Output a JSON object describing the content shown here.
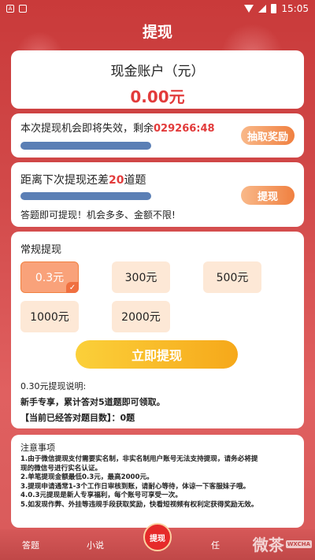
{
  "status_bar": {
    "left_icons": [
      "square-a-icon",
      "sim-icon"
    ],
    "time": "15:05"
  },
  "page": {
    "title": "提现"
  },
  "account": {
    "label": "现金账户（元）",
    "balance": "0.00元"
  },
  "countdown": {
    "prefix": "本次提现机会即将失效，剩余",
    "timer": "029266:48",
    "progress": 0.45,
    "button": "抽取奖励"
  },
  "remaining": {
    "prefix": "距离下次提现还差",
    "count": "20",
    "suffix": "道题",
    "progress": 0.45,
    "button": "提现",
    "note": "答题即可提现！机会多多、金额不限!"
  },
  "withdraw": {
    "title": "常规提现",
    "amounts": [
      "0.3元",
      "300元",
      "500元",
      "1000元",
      "2000元"
    ],
    "selected": "0.3元",
    "button": "立即提现",
    "info1": "0.30元提现说明:",
    "info2": "新手专享，累计答对5道题即可领取。",
    "info3": "【当前已经答对题目数】：0题"
  },
  "notes": {
    "title": "注意事项",
    "items": [
      "1.由于微信提现支付需要实名制，非实名制用户账号无法支持提现，请务必将提",
      "现的微信号进行实名认证。",
      "2.单笔提现金额最低0.3元，最高2000元。",
      "3.提现申请通常1-3个工作日审核到账，请耐心等待，体谅一下客服妹子哦。",
      "4.0.3元提现是新人专享福利，每个账号可享受一次。",
      "5.如发现作弊、外挂等违规手段获取奖励，快看短视频有权利定获得奖励无效。"
    ]
  },
  "nav": {
    "answer": "答题",
    "novel": "小说",
    "center": "提现",
    "task": "任"
  },
  "watermark": {
    "text": "微茶",
    "tag": "WXCHA"
  }
}
